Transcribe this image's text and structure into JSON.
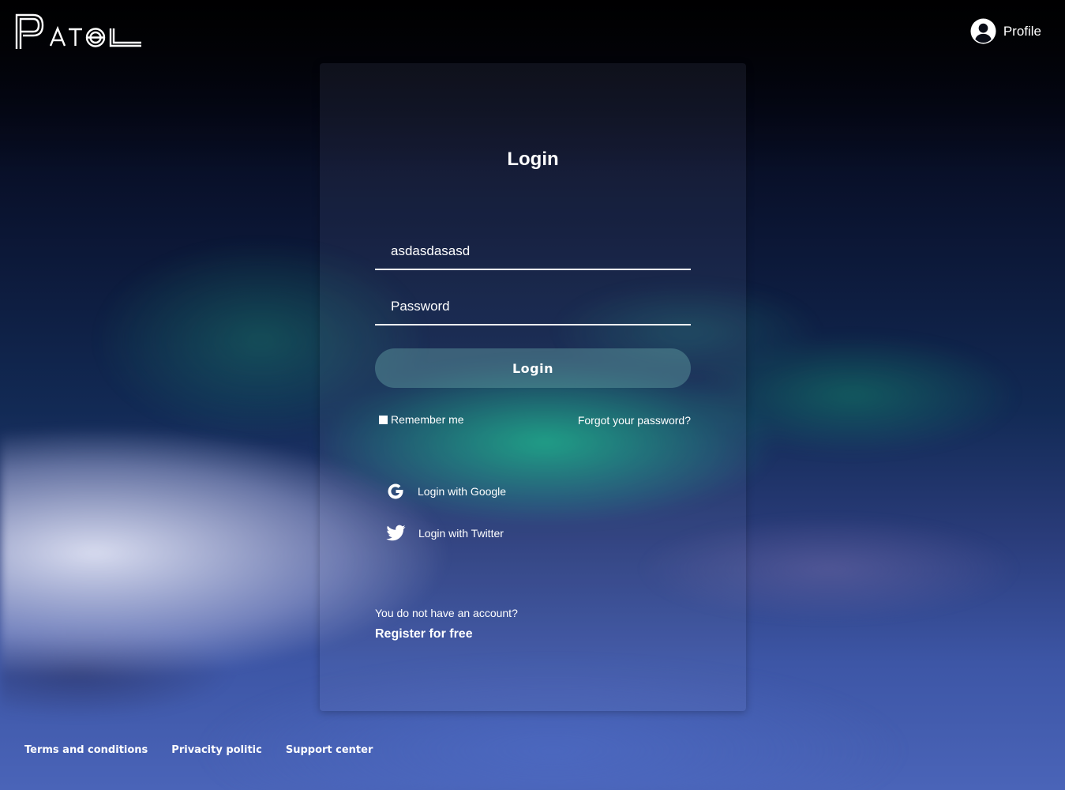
{
  "header": {
    "logo_text": "PATOL",
    "profile_label": "Profile",
    "profile_icon": "user-circle-icon"
  },
  "login_form": {
    "title": "Login",
    "username_value": "asdasdasasd",
    "password_placeholder": "Password",
    "submit_label": "Login",
    "remember_label": "Remember me",
    "remember_checked": false,
    "forgot_label": "Forgot your password?"
  },
  "social": [
    {
      "label": "Login with Google",
      "icon": "google-icon"
    },
    {
      "label": "Login with Twitter",
      "icon": "twitter-icon"
    }
  ],
  "register": {
    "prompt": "You do not have an account?",
    "link_label": "Register for free"
  },
  "footer": {
    "links": [
      "Terms and conditions",
      "Privacity politic",
      "Support center"
    ]
  },
  "colors": {
    "text": "#ffffff",
    "button_bg": "#64a0a5",
    "accent_aurora": "#14c88c"
  }
}
